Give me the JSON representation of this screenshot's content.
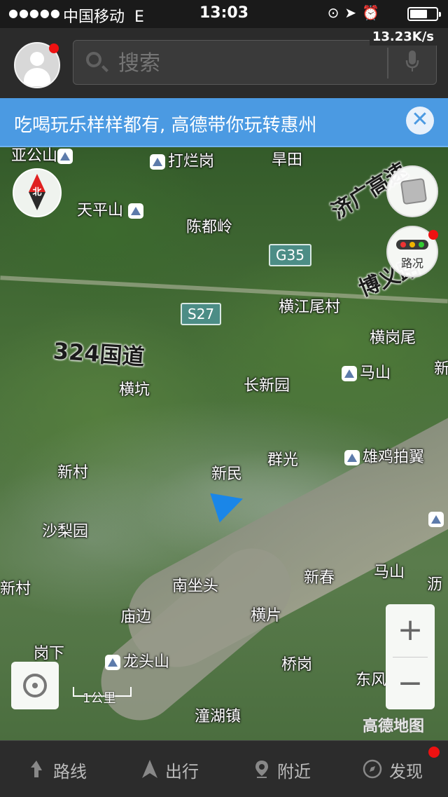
{
  "status_bar": {
    "signal": "●●●●●",
    "carrier": "中国移动",
    "network": "E",
    "time": "13:03",
    "net_speed": "13.23K/s"
  },
  "top_bar": {
    "search_placeholder": "搜索"
  },
  "banner": {
    "text": "吃喝玩乐样样都有, 高德带你玩转惠州",
    "close_glyph": "✕"
  },
  "map": {
    "compass_label": "北",
    "traffic_label": "路况",
    "scale_label": "1公里",
    "logo": "高德地图",
    "zoom_in": "+",
    "zoom_out": "−",
    "road_labels": {
      "jiguang": "济广高速",
      "boyi": "博义路",
      "g324": "324国道"
    },
    "shields": {
      "g35": "G35",
      "s27": "S27"
    },
    "places": {
      "yagongshan": "亚公山",
      "dalangang": "打烂岗",
      "hantian": "旱田",
      "tianpingshan": "天平山",
      "chendouling": "陈都岭",
      "hengjiangweicun": "横江尾村",
      "henggangwei": "横岗尾",
      "mashan1": "马山",
      "hengkeng": "横坑",
      "changxinyuan": "长新园",
      "xinmin": "新民",
      "qunguang": "群光",
      "xiongjipaiyi": "雄鸡拍翼",
      "xincun": "新村",
      "shaliyuan": "沙梨园",
      "nanzuotou": "南坐头",
      "xinchun": "新春",
      "mashan2": "马山",
      "xincun_edge": "新村",
      "li_edge": "沥",
      "miaobian": "庙边",
      "hengpian": "横片",
      "gangxia": "岗下",
      "longtoushan": "龙头山",
      "qiaogang": "桥岗",
      "dongfeng": "东风",
      "tonghuzhen": "潼湖镇",
      "xin_edge": "新"
    }
  },
  "tab_bar": {
    "route": "路线",
    "travel": "出行",
    "nearby": "附近",
    "discover": "发现"
  }
}
